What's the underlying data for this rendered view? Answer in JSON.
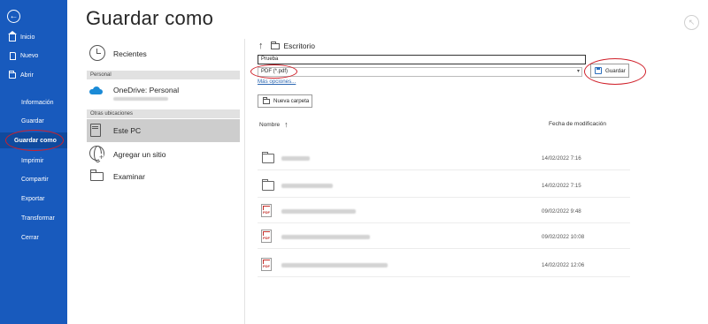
{
  "nav": {
    "back_icon": "arrow-left-circle-icon",
    "items": [
      {
        "label": "Inicio",
        "icon": "home-icon"
      },
      {
        "label": "Nuevo",
        "icon": "document-icon"
      },
      {
        "label": "Abrir",
        "icon": "folder-icon"
      },
      {
        "label": "Información"
      },
      {
        "label": "Guardar"
      },
      {
        "label": "Guardar como",
        "selected": true
      },
      {
        "label": "Imprimir"
      },
      {
        "label": "Compartir"
      },
      {
        "label": "Exportar"
      },
      {
        "label": "Transformar"
      },
      {
        "label": "Cerrar"
      }
    ],
    "bg_color": "#185abd",
    "selected_color": "#0f4a9e"
  },
  "page": {
    "title": "Guardar como"
  },
  "locations": {
    "recent": "Recientes",
    "personal_header": "Personal",
    "onedrive": "OneDrive: Personal",
    "other_header": "Otras ubicaciones",
    "this_pc": "Este PC",
    "add_site": "Agregar un sitio",
    "browse": "Examinar"
  },
  "save_panel": {
    "current_folder": "Escritorio",
    "filename_value": "Prueba",
    "filetype_value": "PDF (*.pdf)",
    "more_options": "Más opciones...",
    "save_button": "Guardar",
    "new_folder_button": "Nueva carpeta",
    "col_name": "Nombre",
    "col_date": "Fecha de modificación"
  },
  "files": [
    {
      "type": "folder",
      "date": "14/02/2022 7:16"
    },
    {
      "type": "folder",
      "date": "14/02/2022 7:15"
    },
    {
      "type": "pdf",
      "date": "09/02/2022 9:48"
    },
    {
      "type": "pdf",
      "date": "09/02/2022 10:08"
    },
    {
      "type": "pdf",
      "date": "14/02/2022 12:06"
    }
  ],
  "colors": {
    "highlight_ellipse": "#d0202a",
    "link": "#2b66b1",
    "pdf_red": "#c4302b"
  }
}
